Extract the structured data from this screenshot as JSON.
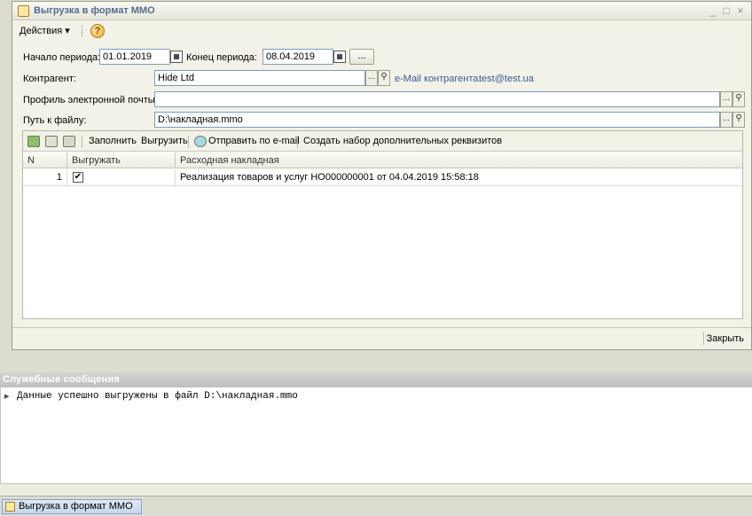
{
  "window": {
    "title": "Выгрузка в формат ММО",
    "controls": {
      "minimize": "_",
      "maximize": "□",
      "close": "×"
    }
  },
  "menu": {
    "actions_label": "Действия ▾",
    "help_label": "?"
  },
  "form": {
    "period_start_label": "Начало периода:",
    "period_start_value": "01.01.2019",
    "period_end_label": "Конец периода:",
    "period_end_value": "08.04.2019",
    "period_button_label": "...",
    "counterparty_label": "Контрагент:",
    "counterparty_value": "Hide Ltd",
    "email_label": "e-Mail контрагента:",
    "email_value": "test@test.ua",
    "mail_profile_label": "Профиль электронной почты:",
    "mail_profile_value": "",
    "file_path_label": "Путь к файлу:",
    "file_path_value": "D:\\накладная.mmo",
    "select_glyph": "...",
    "search_glyph": "🔍"
  },
  "toolbar": {
    "fill_label": "Заполнить",
    "export_label": "Выгрузить",
    "send_email_label": "Отправить по e-mail",
    "create_set_label": "Создать набор дополнительных реквизитов"
  },
  "table": {
    "columns": [
      "N",
      "Выгружать",
      "Расходная накладная"
    ],
    "rows": [
      {
        "n": "1",
        "export_checked": "✔",
        "document": "Реализация товаров и услуг НО000000001 от 04.04.2019 15:58:18"
      }
    ]
  },
  "footer": {
    "close_label": "Закрыть"
  },
  "messages": {
    "title": "Служебные сообщения",
    "items": [
      "Данные успешно выгружены в файл D:\\накладная.mmo"
    ]
  },
  "taskbar": {
    "items": [
      "Выгрузка в формат ММО"
    ]
  }
}
